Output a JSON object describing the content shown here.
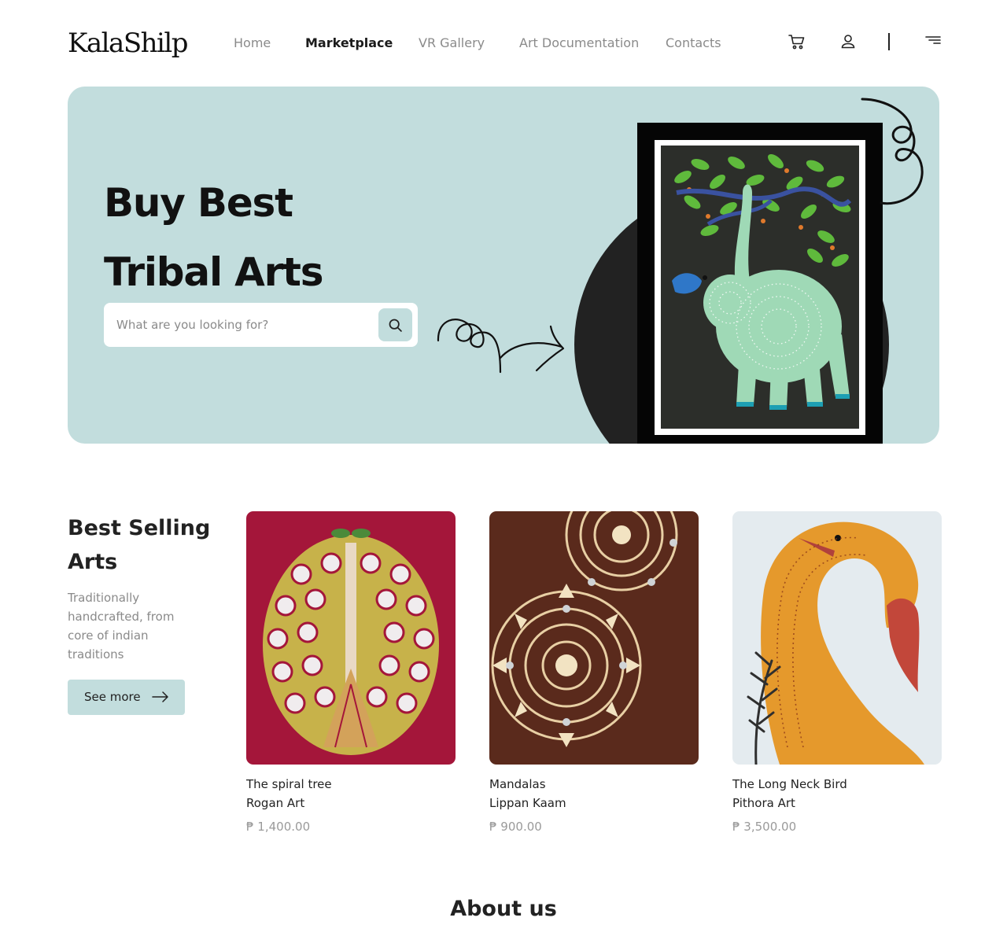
{
  "brand": {
    "logo": "KalaShilp"
  },
  "nav": {
    "items": [
      {
        "label": "Home"
      },
      {
        "label": "Marketplace"
      },
      {
        "label": "VR Gallery"
      },
      {
        "label": "Art Documentation"
      },
      {
        "label": "Contacts"
      }
    ],
    "active": "Marketplace",
    "icons": [
      "cart-icon",
      "user-icon",
      "menu-icon"
    ]
  },
  "hero": {
    "title_line1": "Buy Best",
    "title_line2": "Tribal Arts",
    "search_placeholder": "What are you looking for?",
    "search_icon": "search-icon",
    "background": "#c2dddd"
  },
  "best_selling": {
    "title_line1": "Best Selling",
    "title_line2": "Arts",
    "description": "Traditionally handcrafted, from core of indian traditions",
    "button_label": "See more",
    "button_icon": "arrow-right-icon",
    "products": [
      {
        "name": "The spiral tree",
        "type": "Rogan Art",
        "price": "₱ 1,400.00"
      },
      {
        "name": "Mandalas",
        "type": "Lippan Kaam",
        "price": "₱ 900.00"
      },
      {
        "name": "The Long Neck Bird",
        "type": "Pithora Art",
        "price": "₱ 3,500.00"
      }
    ]
  },
  "about": {
    "title": "About us"
  },
  "colors": {
    "accent": "#c2dddd",
    "text": "#222222",
    "muted": "#8a8a8a"
  }
}
